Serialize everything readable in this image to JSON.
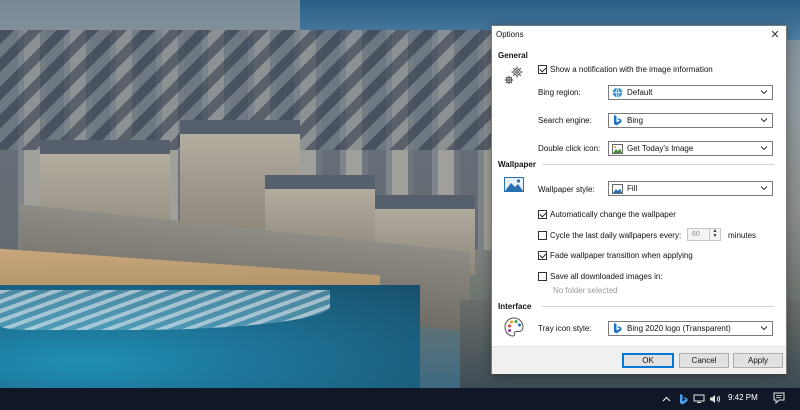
{
  "dialog": {
    "title": "Options",
    "close_glyph": "✕"
  },
  "general": {
    "heading": "General",
    "icon": "gears-icon",
    "show_notification": {
      "label": "Show a notification with the image information",
      "checked": true
    },
    "bing_region": {
      "label": "Bing region:",
      "value": "Default",
      "icon": "globe-icon"
    },
    "search_engine": {
      "label": "Search engine:",
      "value": "Bing",
      "icon": "bing-logo-icon"
    },
    "double_click": {
      "label": "Double click icon:",
      "value": "Get Today's Image",
      "icon": "image-icon"
    }
  },
  "wallpaper": {
    "heading": "Wallpaper",
    "icon": "landscape-picture-icon",
    "style": {
      "label": "Wallpaper style:",
      "value": "Fill",
      "icon": "picture-icon"
    },
    "auto_change": {
      "label": "Automatically change the wallpaper",
      "checked": true
    },
    "cycle": {
      "label": "Cycle the last daily wallpapers every:",
      "checked": false,
      "value": "60",
      "unit": "minutes"
    },
    "fade": {
      "label": "Fade wallpaper transition when applying",
      "checked": true
    },
    "save_all": {
      "label": "Save all downloaded images in:",
      "checked": false,
      "folder": "No folder selected"
    }
  },
  "interface": {
    "heading": "Interface",
    "icon": "palette-icon",
    "tray_style": {
      "label": "Tray icon style:",
      "value": "Bing 2020 logo (Transparent)",
      "icon": "bing-logo-icon"
    }
  },
  "buttons": {
    "ok": "OK",
    "cancel": "Cancel",
    "apply": "Apply"
  },
  "taskbar": {
    "time": "9:42 PM",
    "tray_icons": [
      "chevron-up-icon",
      "bing-logo-icon",
      "network-icon",
      "volume-icon"
    ],
    "notification_icon": "action-center-icon"
  },
  "colors": {
    "accent": "#0078d7",
    "taskbar": "#101827",
    "bing": "#1a73c8"
  }
}
